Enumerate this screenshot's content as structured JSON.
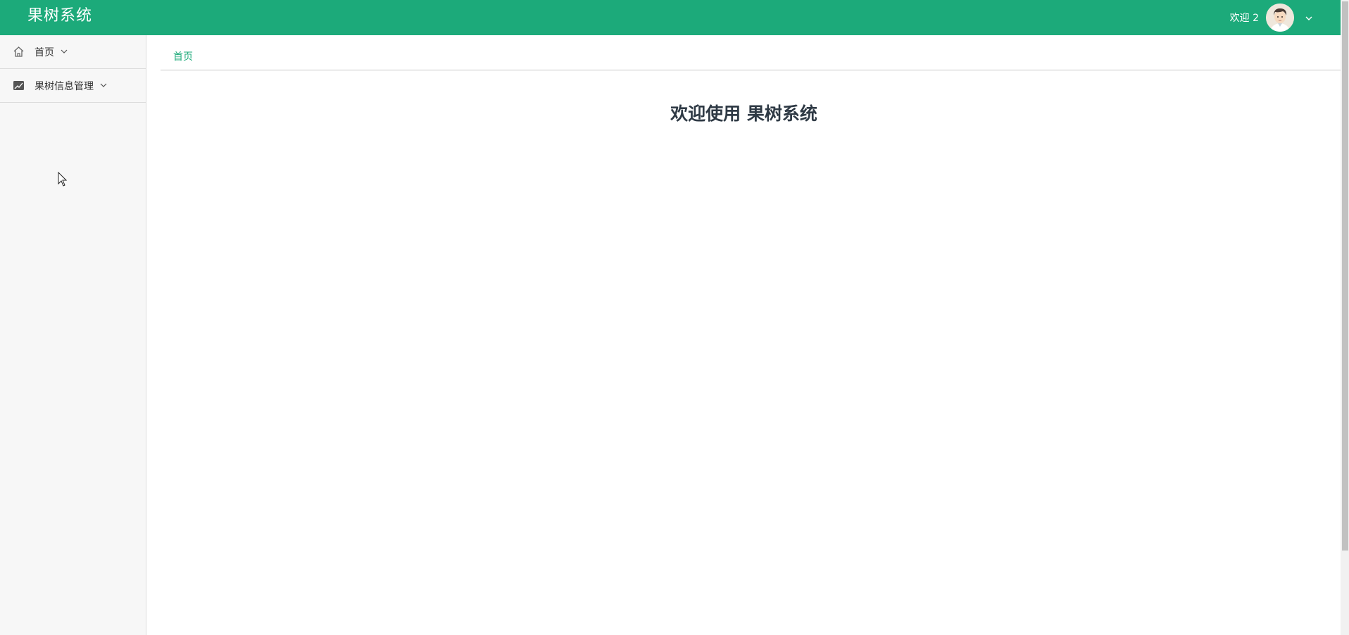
{
  "header": {
    "app_title": "果树系统",
    "welcome": "欢迎 2",
    "accent_color": "#1caa7a"
  },
  "sidebar": {
    "items": [
      {
        "label": "首页",
        "icon": "home-icon"
      },
      {
        "label": "果树信息管理",
        "icon": "image-icon"
      }
    ]
  },
  "tabs": [
    {
      "label": "首页",
      "active": true
    }
  ],
  "main": {
    "heading": "欢迎使用 果树系统"
  }
}
